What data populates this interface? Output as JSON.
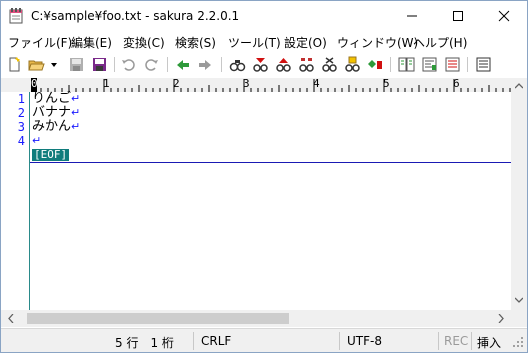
{
  "window": {
    "title": "C:¥sample¥foo.txt - sakura 2.2.0.1",
    "buttons": [
      "minimize-icon",
      "maximize-icon",
      "close-icon"
    ]
  },
  "menu": [
    "ファイル(F)",
    "編集(E)",
    "変換(C)",
    "検索(S)",
    "ツール(T)",
    "設定(O)",
    "ウィンドウ(W)",
    "ヘルプ(H)"
  ],
  "ruler": [
    "0",
    "1",
    "2",
    "3",
    "4",
    "5",
    "6"
  ],
  "editor": {
    "line_numbers": [
      "1",
      "2",
      "3",
      "4"
    ],
    "lines": [
      "りんご",
      "バナナ",
      "みかん",
      ""
    ],
    "return_mark": "↵",
    "eof_label": "[EOF]"
  },
  "status": {
    "position": "5 行　1 桁",
    "line_ending": "CRLF",
    "encoding": "UTF-8",
    "rec": "REC",
    "insert_mode": "挿入"
  },
  "colors": {
    "line_number": "#1a1aff",
    "eof_bg": "#107c7c",
    "gutter_border": "#2a8a8a",
    "cursor_line": "#1a1ab4"
  }
}
